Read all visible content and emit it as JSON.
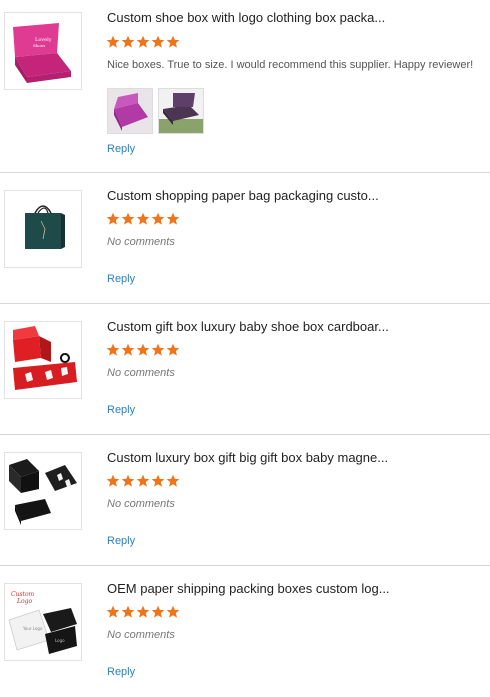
{
  "reviews": [
    {
      "title": "Custom shoe box with logo clothing box packa...",
      "comment": "Nice boxes. True to size. I would recommend this supplier. Happy reviewer!",
      "reply_label": "Reply",
      "stars": 5
    },
    {
      "title": "Custom shopping paper bag packaging custo...",
      "comment": "No comments",
      "reply_label": "Reply",
      "stars": 5
    },
    {
      "title": "Custom gift box luxury baby shoe box cardboar...",
      "comment": "No comments",
      "reply_label": "Reply",
      "stars": 5
    },
    {
      "title": "Custom luxury box gift big gift box baby magne...",
      "comment": "No comments",
      "reply_label": "Reply",
      "stars": 5
    },
    {
      "title": "OEM paper shipping packing boxes custom log...",
      "comment": "No comments",
      "reply_label": "Reply",
      "stars": 5
    }
  ],
  "colors": {
    "star": "#f07419",
    "link": "#2d7fc1",
    "divider": "#d8d8d8"
  }
}
